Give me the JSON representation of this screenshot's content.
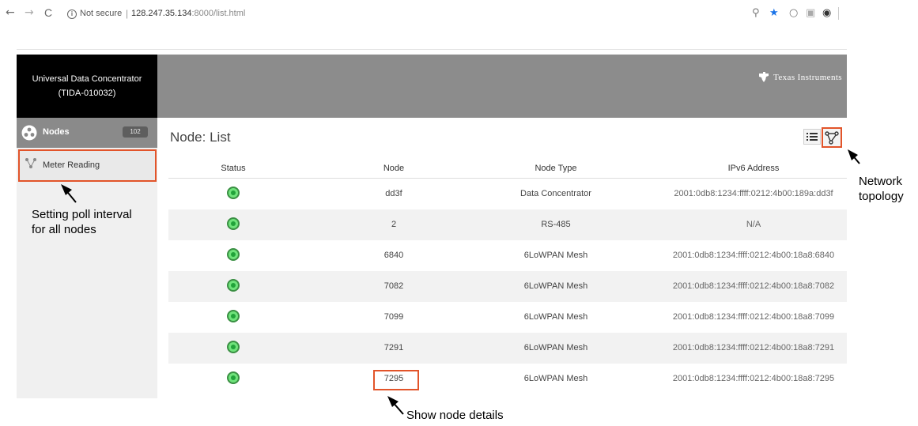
{
  "browser": {
    "back": "←",
    "forward": "→",
    "reload": "C",
    "security": "Not secure",
    "separator": "|",
    "url_host": "128.247.35.134",
    "url_path": ":8000/list.html",
    "zoom_icon": "⚲",
    "star_icon": "★",
    "ext1_icon": "○",
    "ext2_icon": "▣",
    "ext3_icon": "◉"
  },
  "sidebar": {
    "brand_line1": "Universal Data Concentrator",
    "brand_line2": "(TIDA-010032)",
    "nodes_label": "Nodes",
    "nodes_count": "102",
    "meter_label": "Meter Reading"
  },
  "header": {
    "logo_text": "Texas Instruments"
  },
  "main": {
    "title": "Node: List"
  },
  "table": {
    "columns": [
      "Status",
      "Node",
      "Node Type",
      "IPv6 Address"
    ],
    "rows": [
      {
        "node": "dd3f",
        "type": "Data Concentrator",
        "address": "2001:0db8:1234:ffff:0212:4b00:189a:dd3f"
      },
      {
        "node": "2",
        "type": "RS-485",
        "address": "N/A"
      },
      {
        "node": "6840",
        "type": "6LoWPAN Mesh",
        "address": "2001:0db8:1234:ffff:0212:4b00:18a8:6840"
      },
      {
        "node": "7082",
        "type": "6LoWPAN Mesh",
        "address": "2001:0db8:1234:ffff:0212:4b00:18a8:7082"
      },
      {
        "node": "7099",
        "type": "6LoWPAN Mesh",
        "address": "2001:0db8:1234:ffff:0212:4b00:18a8:7099"
      },
      {
        "node": "7291",
        "type": "6LoWPAN Mesh",
        "address": "2001:0db8:1234:ffff:0212:4b00:18a8:7291"
      },
      {
        "node": "7295",
        "type": "6LoWPAN Mesh",
        "address": "2001:0db8:1234:ffff:0212:4b00:18a8:7295"
      }
    ]
  },
  "annotations": {
    "poll_line1": "Setting poll interval",
    "poll_line2": "for all nodes",
    "topology_line1": "Network",
    "topology_line2": "topology",
    "details": "Show node details"
  },
  "colors": {
    "highlight": "#e2542a",
    "status_green": "#21a33a"
  }
}
